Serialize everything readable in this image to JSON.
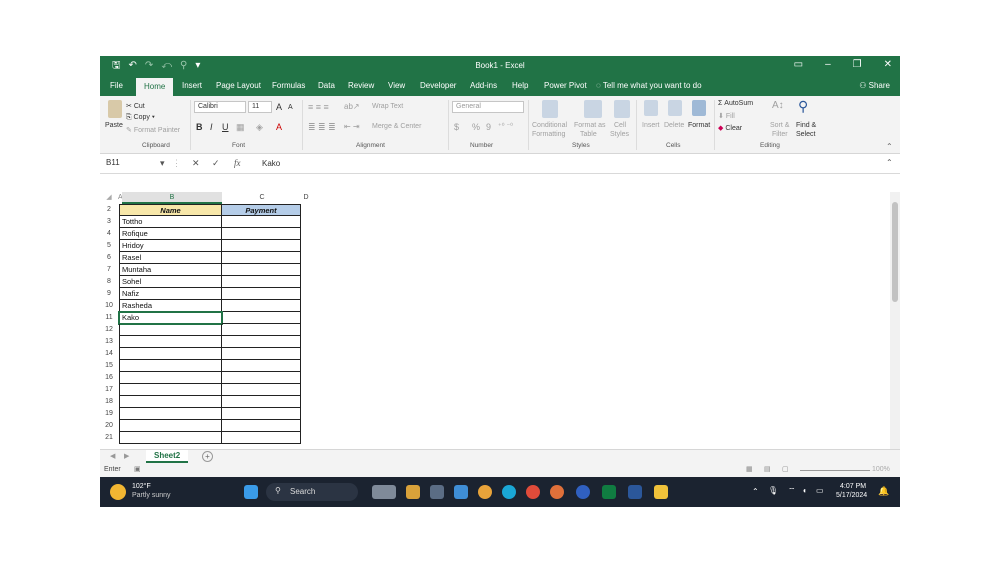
{
  "window": {
    "title": "Book1  -  Excel",
    "qat": [
      "🖫",
      "↶",
      "↷",
      "⤺",
      "⚲",
      "▾"
    ],
    "controls": [
      "▭",
      "–",
      "❐",
      "✕"
    ]
  },
  "tabs": [
    "File",
    "Home",
    "Insert",
    "Page Layout",
    "Formulas",
    "Data",
    "Review",
    "View",
    "Developer",
    "Add-ins",
    "Help",
    "Power Pivot"
  ],
  "tell_me": "Tell me what you want to do",
  "share": "Share",
  "ribbon": {
    "clipboard": {
      "paste": "Paste",
      "cut": "Cut",
      "copy": "Copy ▾",
      "format_painter": "Format Painter",
      "label": "Clipboard"
    },
    "font": {
      "name": "Calibri",
      "size": "11",
      "grow": "A",
      "shrink": "A",
      "bold": "B",
      "italic": "I",
      "underline": "U",
      "label": "Font"
    },
    "alignment": {
      "wrap": "Wrap Text",
      "merge": "Merge & Center",
      "label": "Alignment"
    },
    "number": {
      "format": "General",
      "currency": "$",
      "percent": "%",
      "comma": "9",
      "label": "Number"
    },
    "styles": {
      "conditional": "Conditional",
      "conditional2": "Formatting",
      "format_as": "Format as",
      "format_as2": "Table",
      "cell": "Cell",
      "cell2": "Styles",
      "label": "Styles"
    },
    "cells": {
      "insert": "Insert",
      "delete": "Delete",
      "format": "Format",
      "label": "Cells"
    },
    "editing": {
      "autosum": "AutoSum",
      "fill": "Fill",
      "clear": "Clear",
      "sort": "Sort &",
      "sort2": "Filter",
      "find": "Find &",
      "find2": "Select",
      "label": "Editing"
    }
  },
  "formula_bar": {
    "name_box": "B11",
    "fx": "fx",
    "value": "Kako"
  },
  "columns": [
    "A",
    "B",
    "C",
    "D"
  ],
  "rows": [
    "2",
    "3",
    "4",
    "5",
    "6",
    "7",
    "8",
    "9",
    "10",
    "11",
    "12",
    "13",
    "14",
    "15",
    "16",
    "17",
    "18",
    "19",
    "20",
    "21"
  ],
  "table": {
    "header_name": "Name",
    "header_payment": "Payment",
    "names": [
      "Tottho",
      "Rofique",
      "Hridoy",
      "Rasel",
      "Muntaha",
      "Sohel",
      "Nafiz",
      "Rasheda",
      "Kako",
      "",
      "",
      "",
      "",
      "",
      "",
      "",
      "",
      "",
      ""
    ]
  },
  "sheet": {
    "tab": "Sheet2",
    "add": "+"
  },
  "status": {
    "mode": "Enter",
    "zoom": "100%"
  },
  "taskbar": {
    "weather_temp": "102°F",
    "weather_desc": "Partly sunny",
    "search": "Search",
    "time": "4:07 PM",
    "date": "5/17/2024"
  },
  "colors": {
    "excel_green": "#217346",
    "name_header": "#f7e7a9",
    "payment_header": "#b5cde8"
  }
}
